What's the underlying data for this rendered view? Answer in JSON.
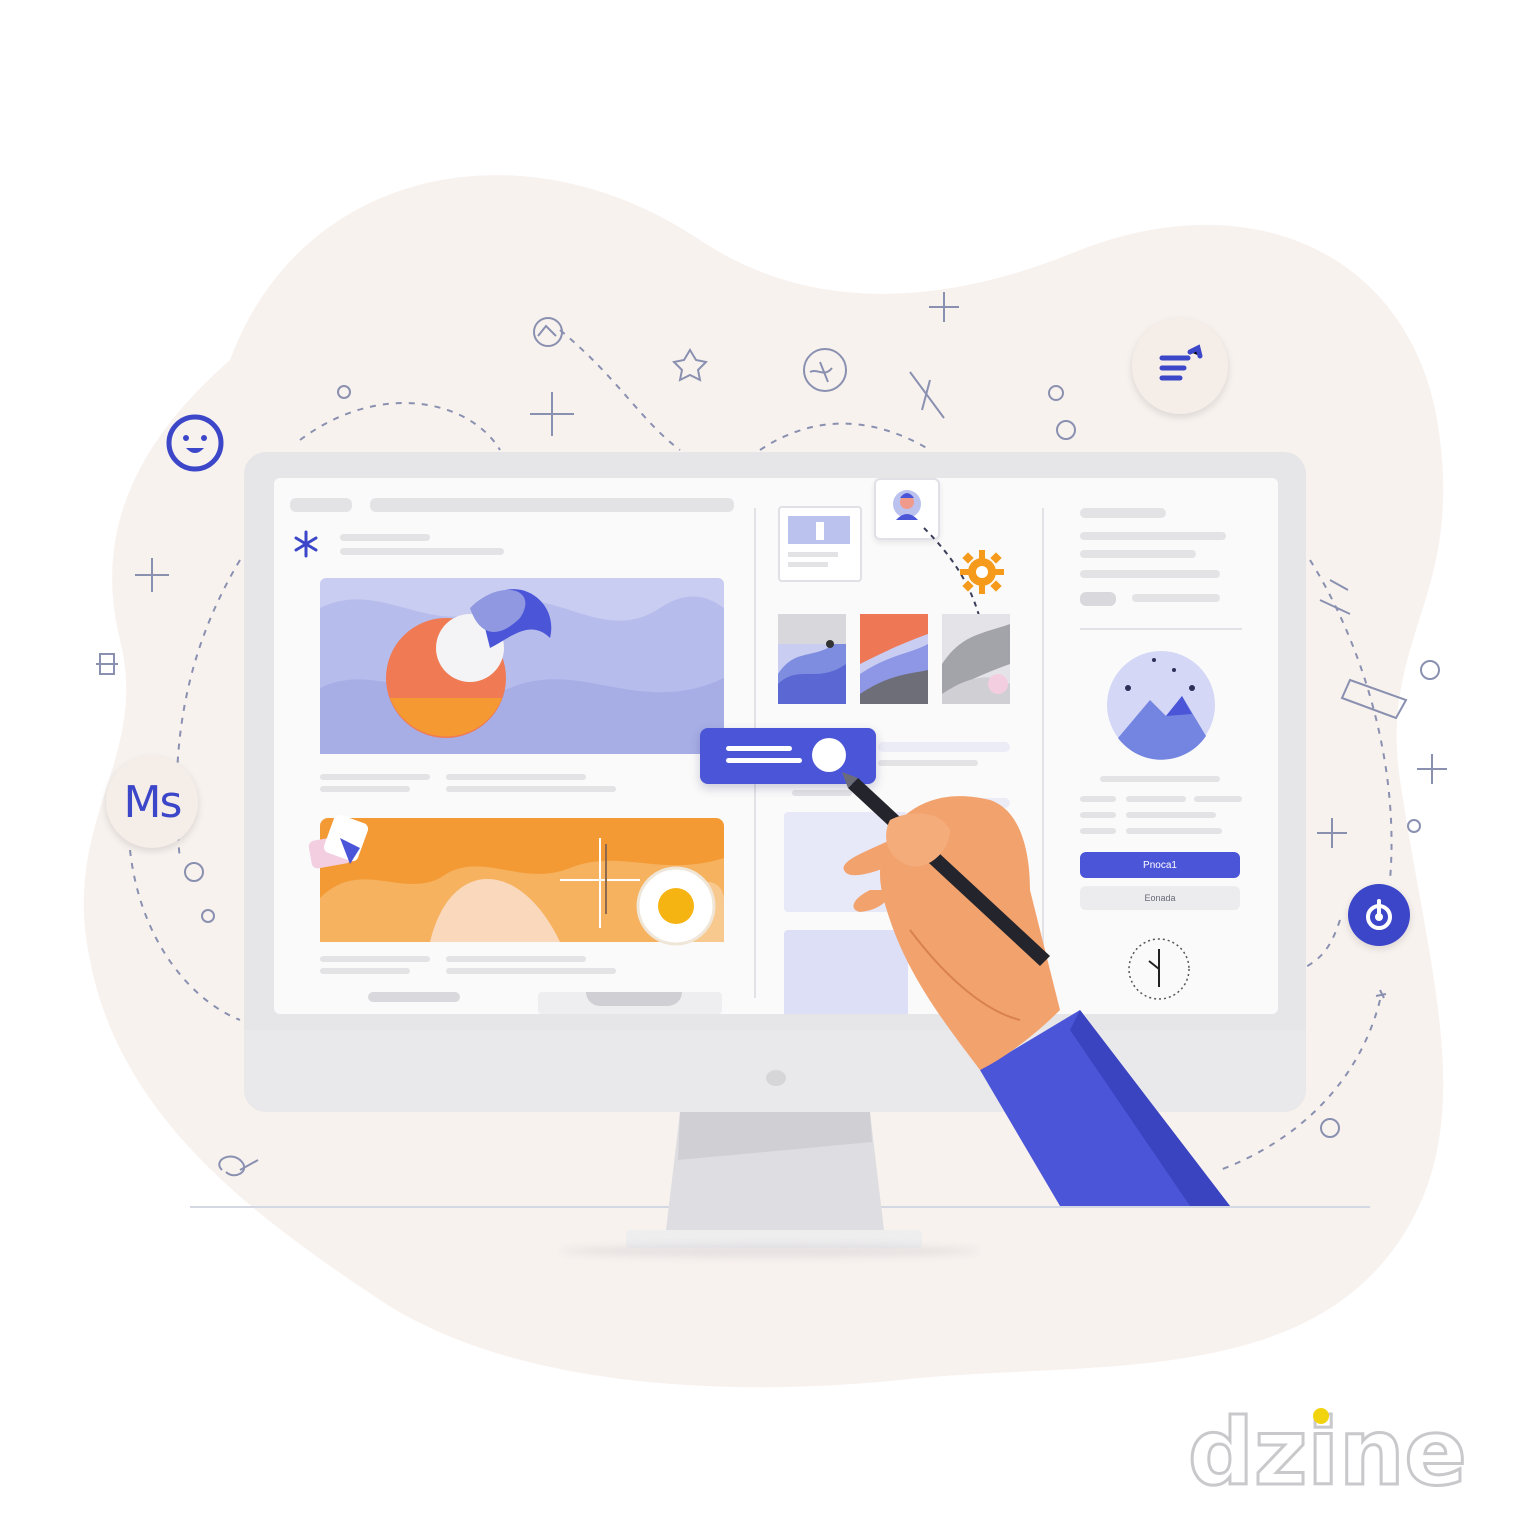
{
  "screen": {
    "primary_button_label": "Pnoca1",
    "secondary_button_label": "Eonada"
  },
  "badges": {
    "ms_label": "Ms"
  },
  "watermark": {
    "text": "dzine"
  },
  "colors": {
    "accent": "#4b55d8",
    "orange": "#f29a3a",
    "coral": "#ee7756",
    "lavender": "#b9bfea",
    "background_blob": "#f7f1ee",
    "sleeve": "#4b55d8"
  },
  "icons": [
    "smiley-icon",
    "ms-badge",
    "menu-lines-icon",
    "power-icon",
    "gear-icon",
    "avatar-icon",
    "clock-icon",
    "sparkle-icon",
    "pen-icon"
  ]
}
